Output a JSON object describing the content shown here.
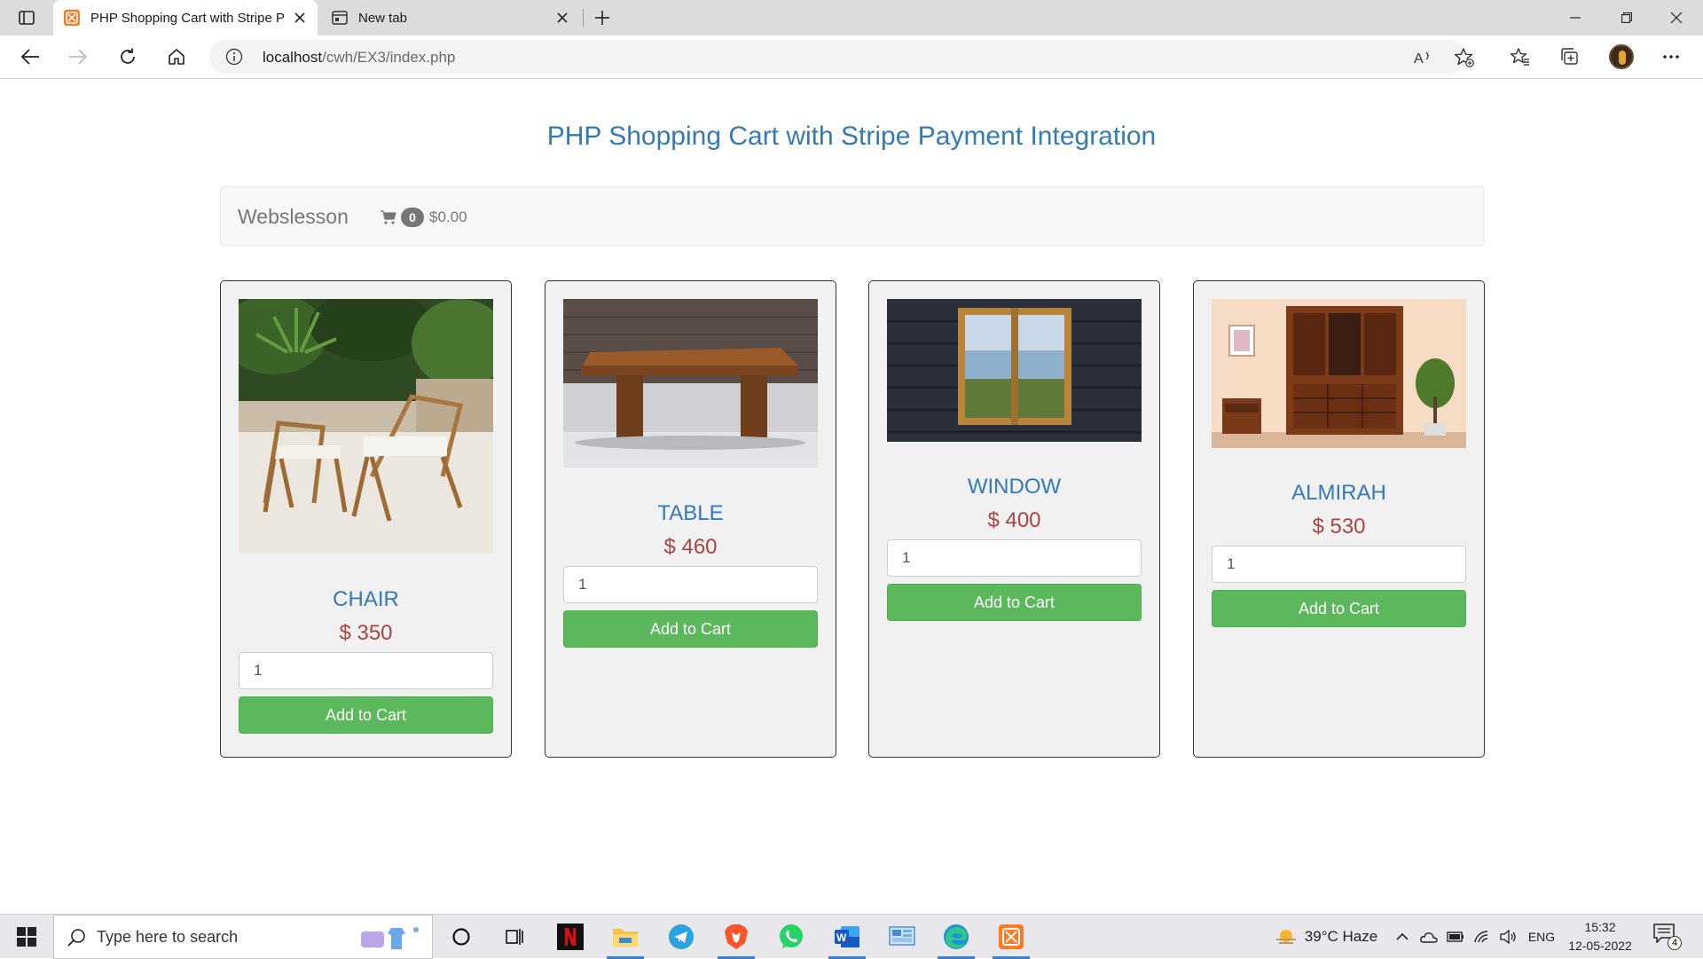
{
  "browser": {
    "tabs": [
      {
        "title": "PHP Shopping Cart with Stripe P",
        "active": true
      },
      {
        "title": "New tab",
        "active": false
      }
    ],
    "url_host": "localhost",
    "url_path": "/cwh/EX3/index.php"
  },
  "page": {
    "title": "PHP Shopping Cart with Stripe Payment Integration",
    "brand": "Webslesson",
    "cart_count": "0",
    "cart_total": "$0.00"
  },
  "products": [
    {
      "name": "CHAIR",
      "price": "$ 350",
      "qty": "1",
      "button": "Add to Cart"
    },
    {
      "name": "TABLE",
      "price": "$ 460",
      "qty": "1",
      "button": "Add to Cart"
    },
    {
      "name": "WINDOW",
      "price": "$ 400",
      "qty": "1",
      "button": "Add to Cart"
    },
    {
      "name": "ALMIRAH",
      "price": "$ 530",
      "qty": "1",
      "button": "Add to Cart"
    }
  ],
  "taskbar": {
    "search_placeholder": "Type here to search",
    "weather": "39°C  Haze",
    "language": "ENG",
    "time": "15:32",
    "date": "12-05-2022",
    "notifications": "4"
  },
  "icons": {
    "tab_actions": "tab-actions-icon",
    "xampp": "xampp-icon",
    "newtab": "new-tab-page-icon",
    "back": "back-arrow-icon",
    "forward": "forward-arrow-icon",
    "reload": "reload-icon",
    "home": "home-icon",
    "cart": "shopping-cart-icon"
  },
  "colors": {
    "title_blue": "#337ab7",
    "price_red": "#a94442",
    "button_green": "#5cb85c",
    "card_bg": "#f1f1f1"
  }
}
